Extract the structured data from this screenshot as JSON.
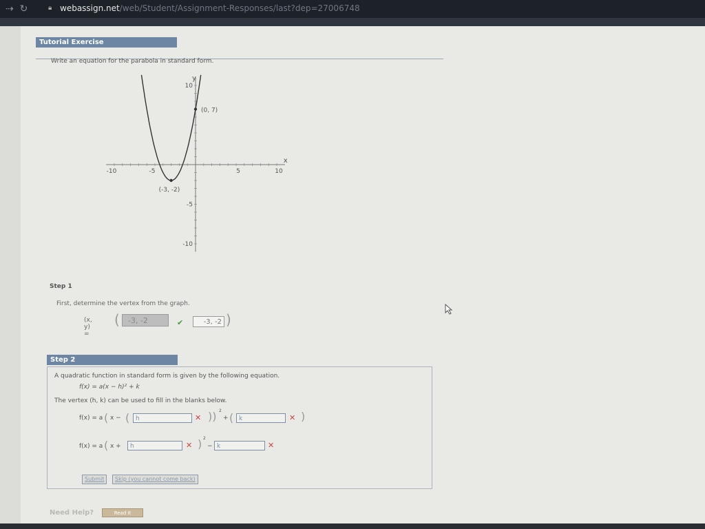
{
  "browser": {
    "host": "webassign.net",
    "path": "/web/Student/Assignment-Responses/last?dep=27006748"
  },
  "tutorial": {
    "header": "Tutorial Exercise",
    "prompt": "Write an equation for the parabola in standard form."
  },
  "graph": {
    "y_axis_label": "y",
    "x_axis_label": "x",
    "x_ticks": [
      "-10",
      "-5",
      "5",
      "10"
    ],
    "y_ticks": [
      "10",
      "-5",
      "-10"
    ],
    "point_label_top": "(0, 7)",
    "point_label_vertex": "(-3, -2)",
    "xlim": [
      -11,
      11
    ],
    "ylim": [
      -11,
      11
    ],
    "vertex": [
      -3,
      -2
    ],
    "point": [
      0,
      7
    ]
  },
  "step1": {
    "label": "Step 1",
    "text": "First, determine the vertex from the graph.",
    "xy_label": "(x, y) =",
    "entered": "-3, -2",
    "answer": "-3, -2"
  },
  "step2": {
    "header": "Step 2",
    "intro": "A quadratic function in standard form is given by the following equation.",
    "formula": "f(x) = a(x − h)² + k",
    "vertex_text": "The vertex (h, k) can be used to fill in the blanks below.",
    "row1_prefix": "f(x) = a",
    "row1_minus": "x −",
    "row1_h": "h",
    "row1_k": "k",
    "row2_prefix": "f(x) = a",
    "row2_plus": "x +",
    "row2_h": "h",
    "row2_k": "k",
    "submit": "Submit",
    "skip": "Skip (you cannot come back)"
  },
  "help": {
    "need_help": "Need Help?",
    "read_it": "Read It"
  }
}
